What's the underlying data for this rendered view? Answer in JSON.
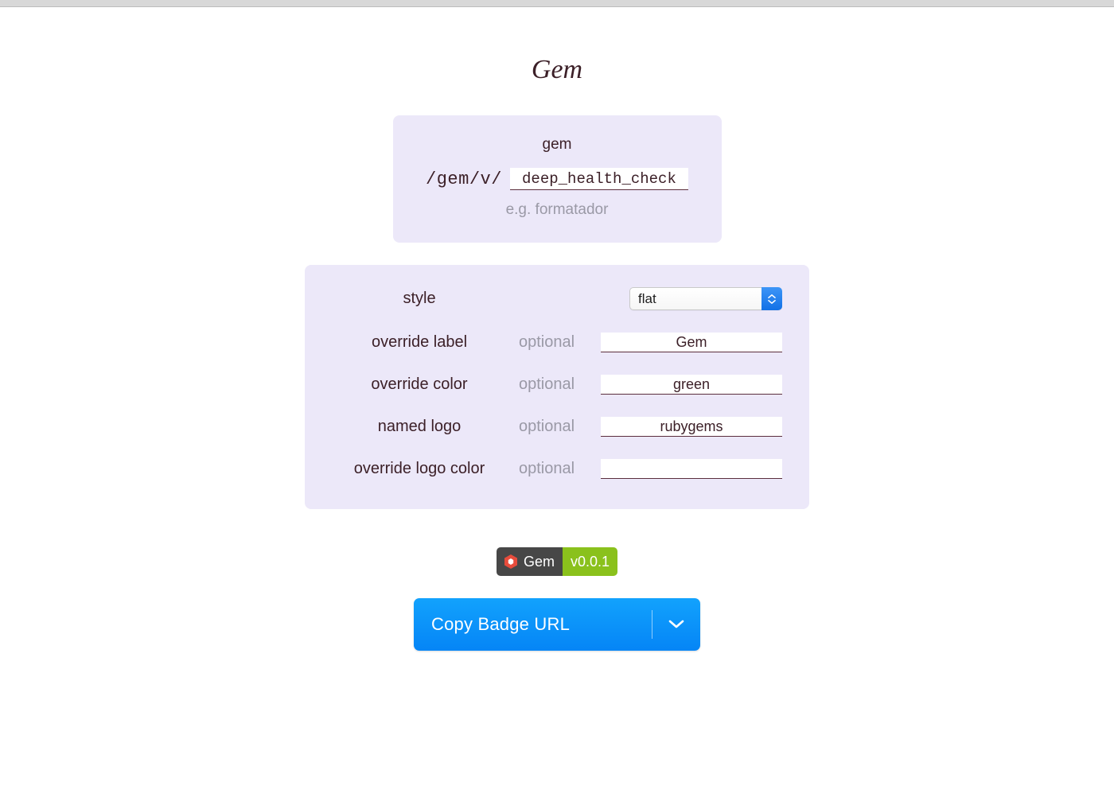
{
  "title": "Gem",
  "path_panel": {
    "param_title": "gem",
    "prefix": "/gem/v/",
    "value": "deep_health_check",
    "hint": "e.g. formatador"
  },
  "options": {
    "style": {
      "label": "style",
      "value": "flat"
    },
    "override_label": {
      "label": "override label",
      "optional": "optional",
      "value": "Gem"
    },
    "override_color": {
      "label": "override color",
      "optional": "optional",
      "value": "green"
    },
    "named_logo": {
      "label": "named logo",
      "optional": "optional",
      "value": "rubygems"
    },
    "override_logo_color": {
      "label": "override logo color",
      "optional": "optional",
      "value": ""
    }
  },
  "badge": {
    "label": "Gem",
    "value": "v0.0.1",
    "logo": "rubygems-icon"
  },
  "copy_button": {
    "label": "Copy Badge URL"
  }
}
